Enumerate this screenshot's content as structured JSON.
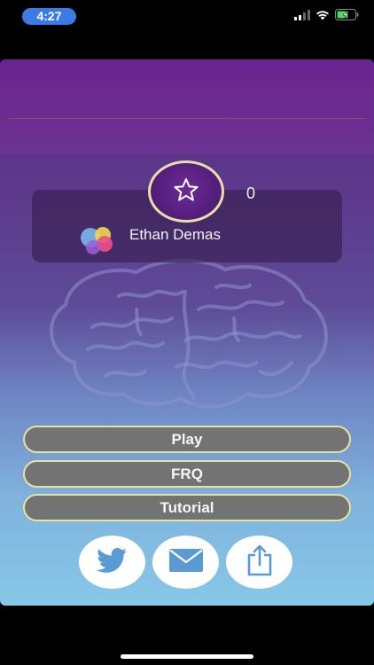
{
  "status_bar": {
    "time": "4:27",
    "signal_icon": "cellular-signal-icon",
    "wifi_icon": "wifi-icon",
    "battery_icon": "battery-charging-icon",
    "time_pill_color": "#3b7be8"
  },
  "profile": {
    "player_name": "Ethan Demas",
    "score": "0",
    "score_icon": "star-icon",
    "avatar_icon": "game-center-bubbles-icon"
  },
  "menu": {
    "play_label": "Play",
    "frq_label": "FRQ",
    "tutorial_label": "Tutorial",
    "button_bg": "#737373",
    "button_border": "#e6e2a2"
  },
  "share": {
    "twitter_icon": "twitter-bird-icon",
    "mail_icon": "mail-envelope-icon",
    "export_icon": "share-export-icon",
    "icon_color": "#5a9bd6"
  },
  "theme": {
    "header_color": "#6a2390",
    "gradient_top": "#5b2a86",
    "gradient_bottom": "#86c8e8",
    "background_image": "brain-outline-icon"
  }
}
